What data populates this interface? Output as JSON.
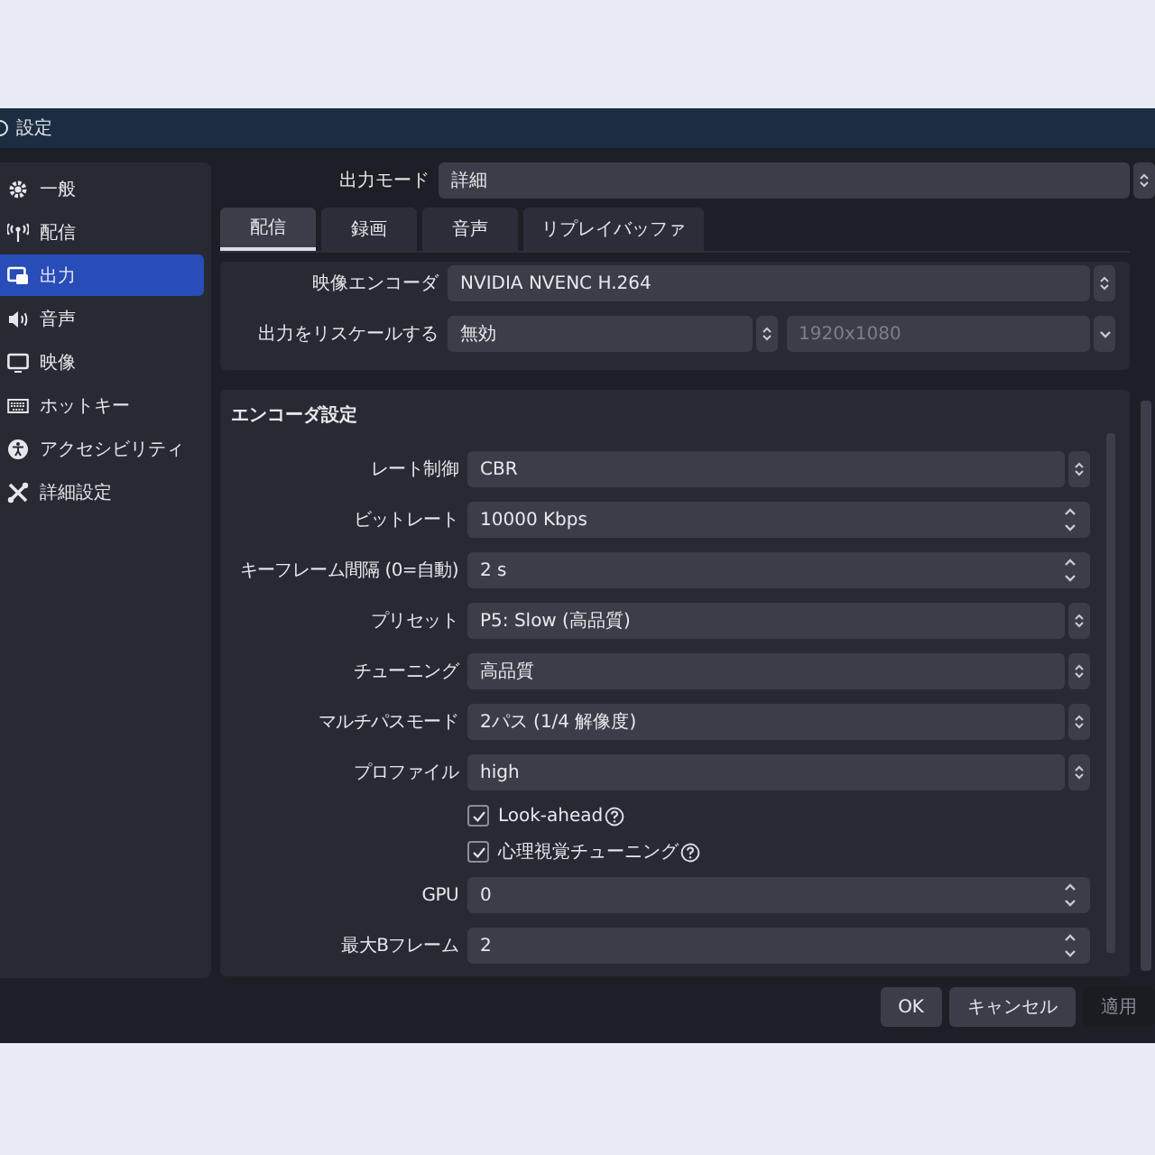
{
  "window": {
    "title": "設定"
  },
  "sidebar": {
    "items": [
      {
        "label": "一般",
        "selected": false
      },
      {
        "label": "配信",
        "selected": false
      },
      {
        "label": "出力",
        "selected": true
      },
      {
        "label": "音声",
        "selected": false
      },
      {
        "label": "映像",
        "selected": false
      },
      {
        "label": "ホットキー",
        "selected": false
      },
      {
        "label": "アクセシビリティ",
        "selected": false
      },
      {
        "label": "詳細設定",
        "selected": false
      }
    ]
  },
  "output_mode": {
    "label": "出力モード",
    "kind": "select",
    "value": "詳細"
  },
  "tabs": [
    {
      "label": "配信",
      "selected": true
    },
    {
      "label": "録画",
      "selected": false
    },
    {
      "label": "音声",
      "selected": false
    },
    {
      "label": "リプレイバッファ",
      "selected": false
    }
  ],
  "stream_settings": {
    "rows": [
      {
        "label": "映像エンコーダ",
        "controls": [
          {
            "kind": "select",
            "value": "NVIDIA NVENC H.264",
            "disabled": false
          }
        ]
      },
      {
        "label": "出力をリスケールする",
        "controls": [
          {
            "kind": "select",
            "value": "無効",
            "disabled": false
          },
          {
            "kind": "dropdown",
            "value": "1920x1080",
            "disabled": true
          }
        ]
      }
    ]
  },
  "encoder_settings": {
    "title": "エンコーダ設定",
    "rows": [
      {
        "kind": "select",
        "label": "レート制御",
        "value": "CBR"
      },
      {
        "kind": "spin",
        "label": "ビットレート",
        "value": "10000 Kbps"
      },
      {
        "kind": "spin",
        "label": "キーフレーム間隔 (0=自動)",
        "value": "2 s"
      },
      {
        "kind": "select",
        "label": "プリセット",
        "value": "P5: Slow (高品質)"
      },
      {
        "kind": "select",
        "label": "チューニング",
        "value": "高品質"
      },
      {
        "kind": "select",
        "label": "マルチパスモード",
        "value": "2パス (1/4 解像度)"
      },
      {
        "kind": "select",
        "label": "プロファイル",
        "value": "high"
      },
      {
        "kind": "checkbox",
        "label": "Look-ahead",
        "checked": true
      },
      {
        "kind": "checkbox",
        "label": "心理視覚チューニング",
        "checked": true
      },
      {
        "kind": "spin",
        "label": "GPU",
        "value": "0"
      },
      {
        "kind": "spin",
        "label": "最大Bフレーム",
        "value": "2"
      }
    ]
  },
  "buttons": [
    {
      "label": "OK",
      "disabled": false
    },
    {
      "label": "キャンセル",
      "disabled": false
    },
    {
      "label": "適用",
      "disabled": true
    }
  ]
}
